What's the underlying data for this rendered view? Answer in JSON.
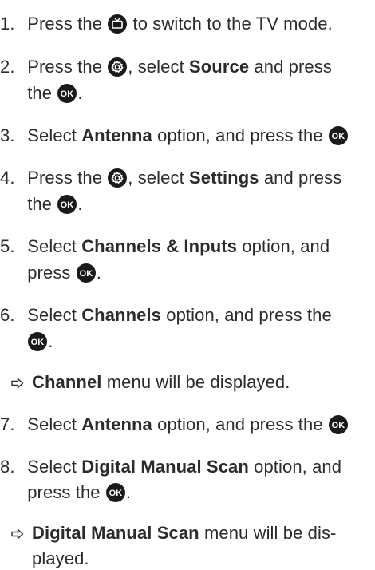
{
  "steps": [
    {
      "n": "1.",
      "l1a": "Press the",
      "l1b": "to switch to the TV mode."
    },
    {
      "n": "2.",
      "l1a": "Press the",
      "l1b": ", select",
      "l1c": "Source",
      "l1d": "and press",
      "l2a": "the",
      "l2b": "."
    },
    {
      "n": "3.",
      "l1a": "Select",
      "l1b": "Antenna",
      "l1c": "option, and press the"
    },
    {
      "n": "4.",
      "l1a": "Press the",
      "l1b": ", select",
      "l1c": "Settings",
      "l1d": "and press",
      "l2a": "the",
      "l2b": "."
    },
    {
      "n": "5.",
      "l1a": "Select",
      "l1b": "Channels & Inputs",
      "l1c": "option, and",
      "l2a": "press",
      "l2b": "."
    },
    {
      "n": "6.",
      "l1a": "Select",
      "l1b": "Channels",
      "l1c": "option, and press the",
      "l2b": "."
    },
    {
      "n": "7.",
      "l1a": "Select",
      "l1b": "Antenna",
      "l1c": "option, and press the"
    },
    {
      "n": "8.",
      "l1a": "Select",
      "l1b": "Digital Manual Scan",
      "l1c": "option, and",
      "l2a": "press the",
      "l2b": "."
    }
  ],
  "results": [
    {
      "bold": "Channel",
      "text": "menu will be displayed."
    },
    {
      "bold": "Digital Manual Scan",
      "text": "menu will be dis-",
      "text2": "played."
    }
  ],
  "icons": {
    "tv": "tv-icon",
    "settings": "gear-icon",
    "ok": "ok-button-icon",
    "result_arrow": "right-arrow-icon"
  }
}
